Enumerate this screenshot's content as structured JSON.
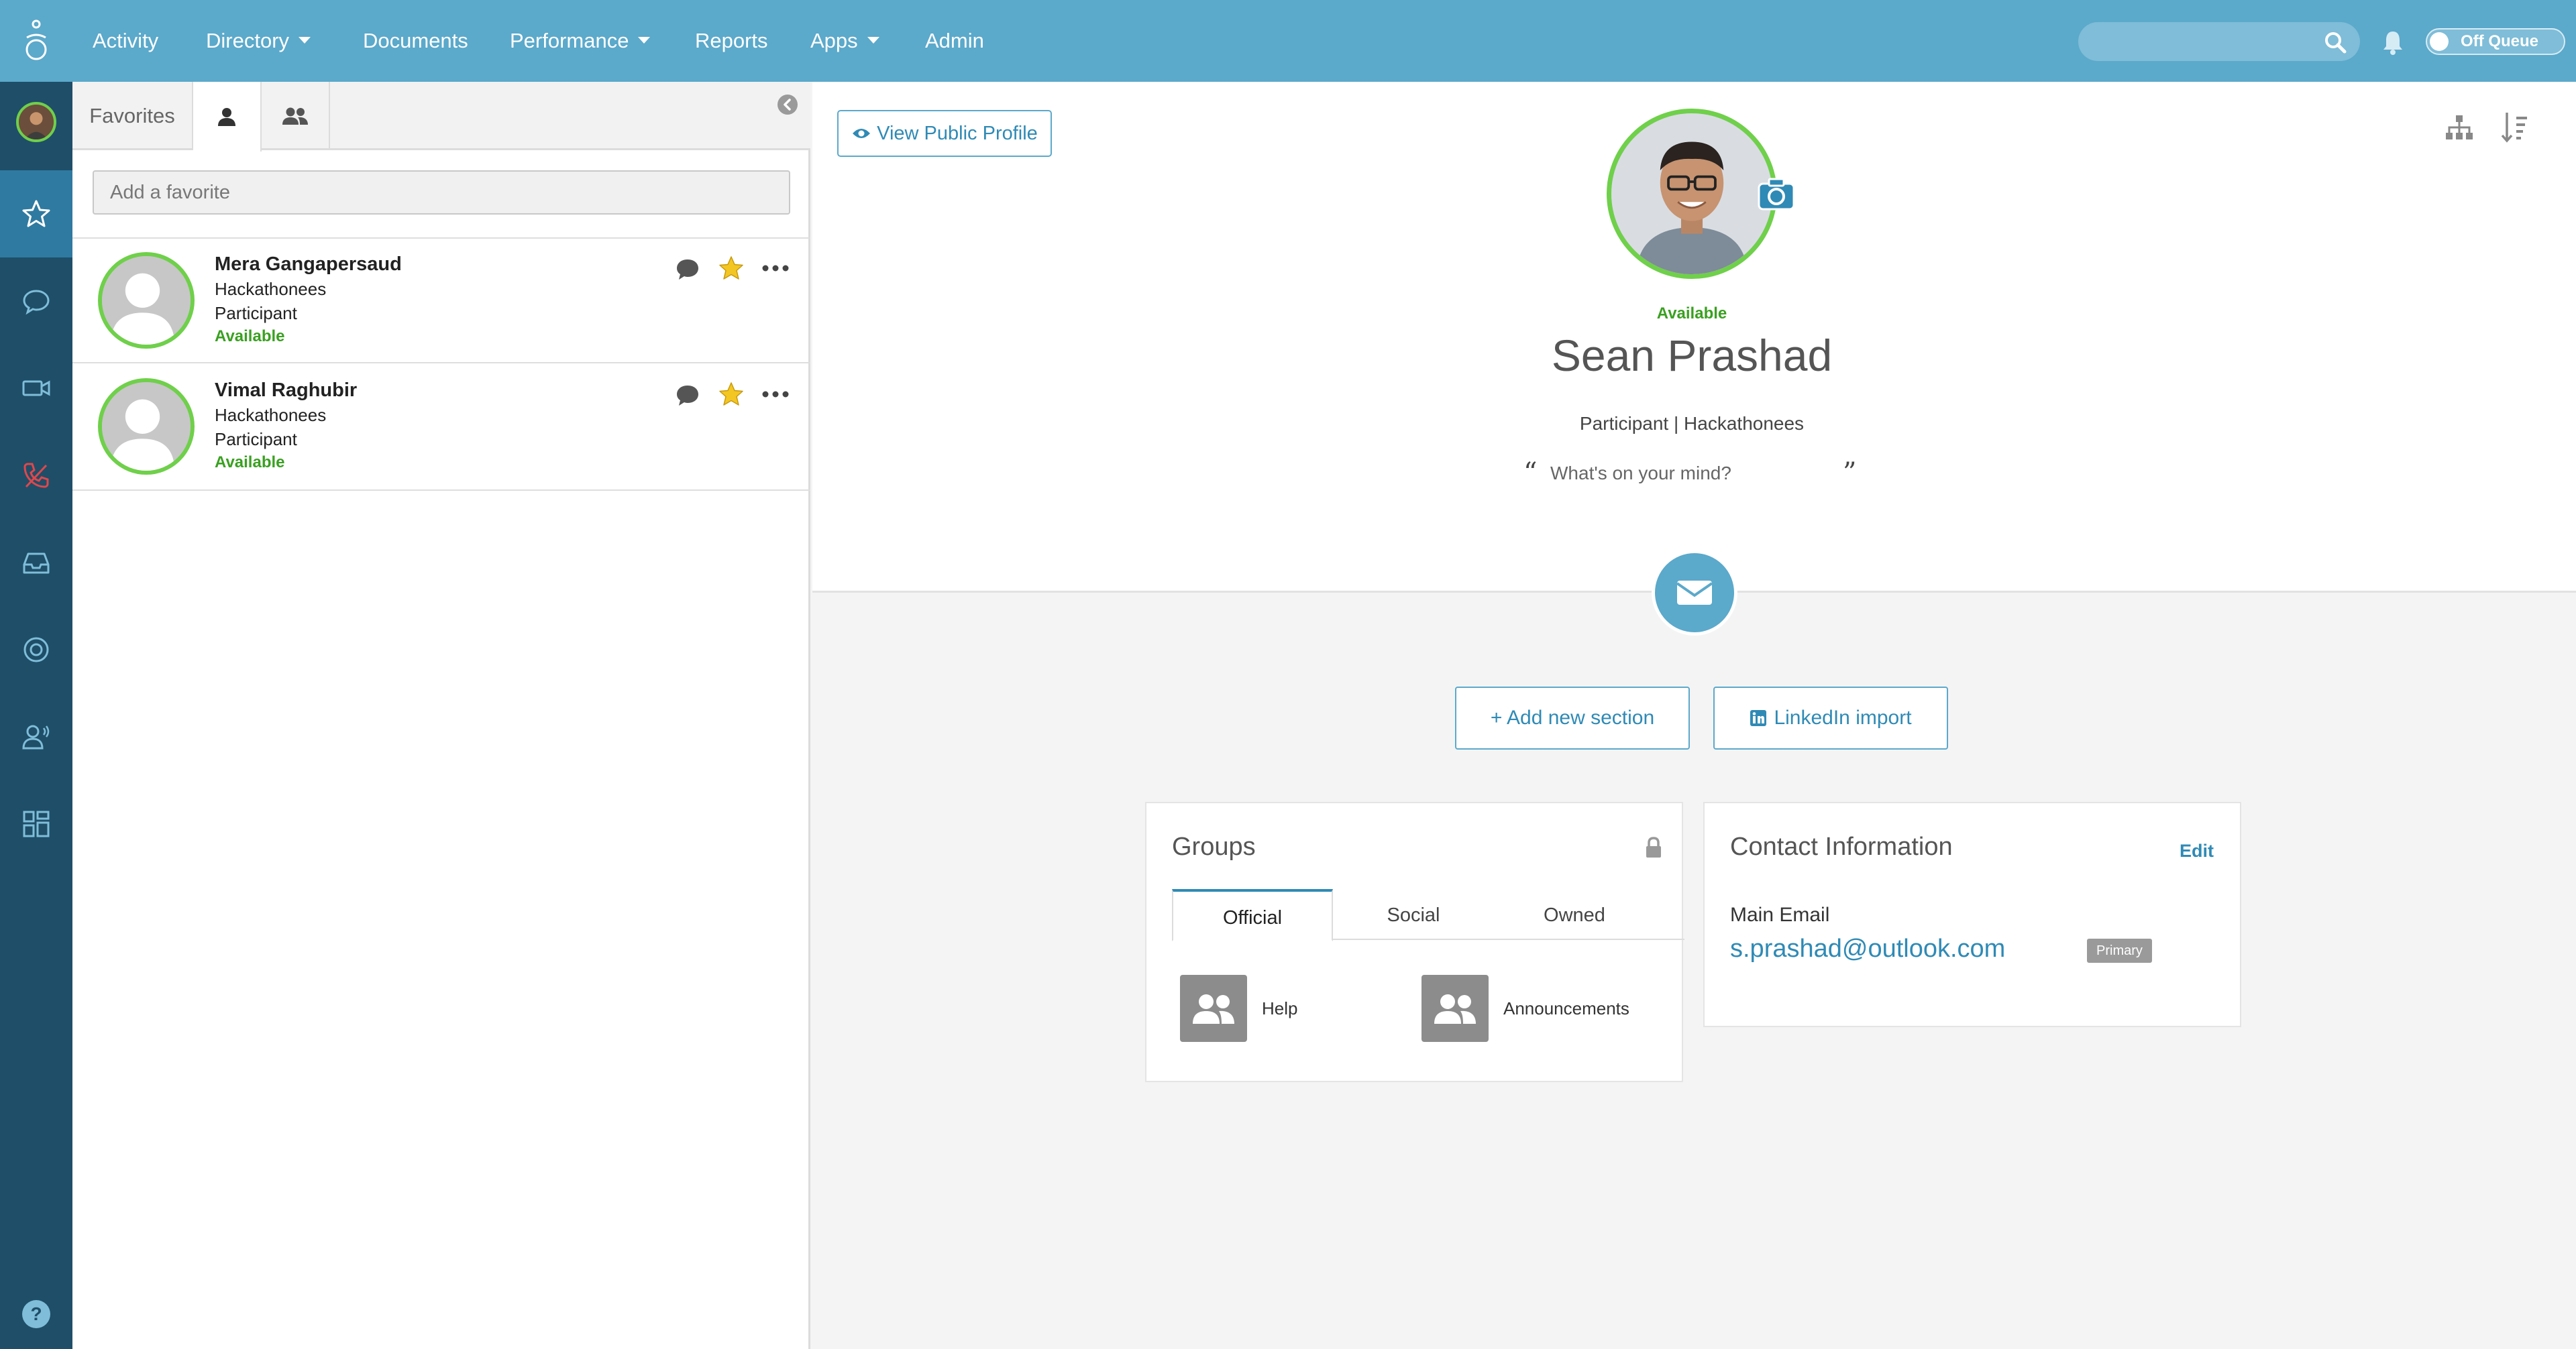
{
  "topnav": {
    "items": [
      {
        "label": "Activity",
        "dropdown": false
      },
      {
        "label": "Directory",
        "dropdown": true
      },
      {
        "label": "Documents",
        "dropdown": false
      },
      {
        "label": "Performance",
        "dropdown": true
      },
      {
        "label": "Reports",
        "dropdown": false
      },
      {
        "label": "Apps",
        "dropdown": true
      },
      {
        "label": "Admin",
        "dropdown": false
      }
    ],
    "search_placeholder": "",
    "queue_label": "Off Queue"
  },
  "rail": {
    "icons": [
      "star-icon",
      "chat-bubble-icon",
      "video-icon",
      "phone-icon",
      "inbox-icon",
      "lifebuoy-icon",
      "agent-icon",
      "apps-grid-icon",
      "help-icon"
    ]
  },
  "favorites": {
    "tab_label": "Favorites",
    "add_placeholder": "Add a favorite",
    "contacts": [
      {
        "name": "Mera Gangapersaud",
        "dept": "Hackathonees",
        "role": "Participant",
        "status": "Available"
      },
      {
        "name": "Vimal Raghubir",
        "dept": "Hackathonees",
        "role": "Participant",
        "status": "Available"
      }
    ]
  },
  "profile": {
    "view_public_label": "View Public Profile",
    "status": "Available",
    "name": "Sean Prashad",
    "role_line": "Participant |  Hackathonees",
    "mind_placeholder": "What's on your mind?",
    "add_section_label": "+ Add new section",
    "linkedin_label": "LinkedIn import"
  },
  "groups": {
    "title": "Groups",
    "tabs": [
      "Official",
      "Social",
      "Owned"
    ],
    "active_tab": "Official",
    "items": [
      "Help",
      "Announcements"
    ]
  },
  "contact_info": {
    "title": "Contact Information",
    "edit_label": "Edit",
    "email_label": "Main Email",
    "email_value": "s.prashad@outlook.com",
    "badge": "Primary"
  },
  "colors": {
    "topbar": "#5ba9cb",
    "rail": "#1f4e68",
    "accent": "#2f8ab5",
    "available": "#3aa021",
    "presence_ring": "#6fd04a"
  }
}
